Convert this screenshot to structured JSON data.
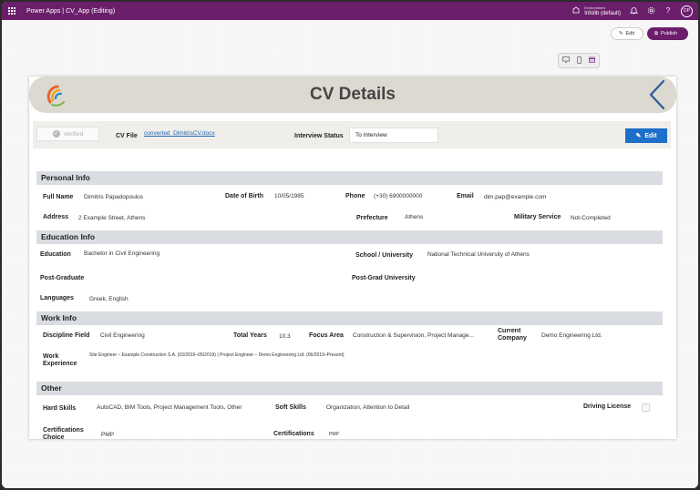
{
  "topbar": {
    "app_name": "Power Apps  |  CV_App (Editing)",
    "environment_label": "Environment",
    "environment_name": "Infolib (default)",
    "avatar": "DP"
  },
  "toolbar": {
    "edit_label": "Edit",
    "publish_label": "Publish"
  },
  "colors": {
    "brand": "#6b1f6b",
    "header_bg": "#dcd9d1",
    "section_bg": "#d9dde1",
    "edit_button": "#1e6fc9",
    "back_arrow": "#2b5a9a"
  },
  "app": {
    "title": "CV Details",
    "verified_label": "Verified",
    "cv_file_label": "CV File",
    "cv_file_link": "converted_DimitrisCV.docx",
    "interview_status_label": "Interview Status",
    "interview_status_value": "To Interview",
    "edit_label": "Edit"
  },
  "personal": {
    "heading": "Personal Info",
    "full_name_label": "Full Name",
    "full_name": "Dimitris Papadopoulos",
    "dob_label": "Date of Birth",
    "dob": "10/05/1985",
    "phone_label": "Phone",
    "phone": "(+30) 6900000000",
    "email_label": "Email",
    "email": "dim.pap@example.com",
    "address_label": "Address",
    "address": "2 Example Street, Athens",
    "prefecture_label": "Prefecture",
    "prefecture": "Athens",
    "military_label": "Military Service",
    "military": "Not-Completed"
  },
  "education": {
    "heading": "Education Info",
    "education_label": "Education",
    "education": "Bachelor in Civil Engineering",
    "school_label": "School / University",
    "school": "National Technical University of Athens",
    "postgrad_label": "Post-Graduate",
    "postgrad_uni_label": "Post-Grad University",
    "languages_label": "Languages",
    "languages": "Greek, English"
  },
  "work": {
    "heading": "Work Info",
    "discipline_label": "Discipline Field",
    "discipline": "Civil Engineering",
    "total_years_label": "Total Years",
    "total_years": "10.3",
    "focus_label": "Focus Area",
    "focus": "Construction & Supervision, Project Manage...",
    "company_label_1": "Current",
    "company_label_2": "Company",
    "company": "Demo Engineering Ltd.",
    "experience_label_1": "Work",
    "experience_label_2": "Experience",
    "experience": "Site Engineer – Example Construction S.A. (03/2016–05/2019) | Project Engineer – Demo Engineering Ltd. (06/2019–Present)"
  },
  "other": {
    "heading": "Other",
    "hard_skills_label": "Hard Skills",
    "hard_skills": "AutoCAD, BIM Tools, Project Management Tools, Other",
    "soft_skills_label": "Soft Skills",
    "soft_skills": "Organization, Attention to Detail",
    "driving_label": "Driving License",
    "cert_choice_label_1": "Certifications",
    "cert_choice_label_2": "Choice",
    "cert_choice": "PMP",
    "certifications_label": "Certifications",
    "certifications": "PMP"
  }
}
